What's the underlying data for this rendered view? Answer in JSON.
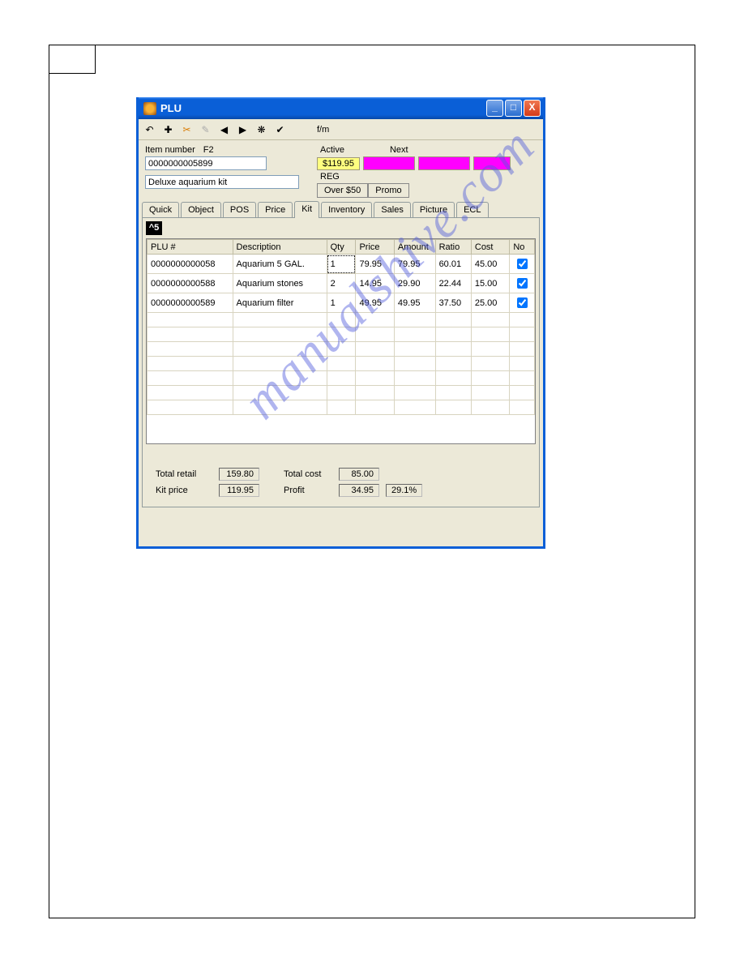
{
  "watermark": "manualshive.com",
  "window": {
    "title": "PLU",
    "toolbar_mode": "f/m",
    "item_number_label": "Item number",
    "f2_label": "F2",
    "item_number": "0000000005899",
    "description": "Deluxe aquarium kit",
    "active_label": "Active",
    "next_label": "Next",
    "price": "$119.95",
    "reg_label": "REG",
    "btn_over50": "Over $50",
    "btn_promo": "Promo"
  },
  "tabs": {
    "quick": "Quick",
    "object": "Object",
    "pos": "POS",
    "price": "Price",
    "kit": "Kit",
    "inventory": "Inventory",
    "sales": "Sales",
    "picture": "Picture",
    "ecl": "ECL"
  },
  "caret5": "^5",
  "grid": {
    "headers": {
      "plu": "PLU #",
      "desc": "Description",
      "qty": "Qty",
      "price": "Price",
      "amount": "Amount",
      "ratio": "Ratio",
      "cost": "Cost",
      "no": "No"
    },
    "rows": [
      {
        "plu": "0000000000058",
        "desc": "Aquarium 5 GAL.",
        "qty": "1",
        "price": "79.95",
        "amount": "79.95",
        "ratio": "60.01",
        "cost": "45.00",
        "no": true
      },
      {
        "plu": "0000000000588",
        "desc": "Aquarium stones",
        "qty": "2",
        "price": "14.95",
        "amount": "29.90",
        "ratio": "22.44",
        "cost": "15.00",
        "no": true
      },
      {
        "plu": "0000000000589",
        "desc": "Aquarium filter",
        "qty": "1",
        "price": "49.95",
        "amount": "49.95",
        "ratio": "37.50",
        "cost": "25.00",
        "no": true
      }
    ]
  },
  "totals": {
    "total_retail_label": "Total retail",
    "total_retail": "159.80",
    "kit_price_label": "Kit price",
    "kit_price": "119.95",
    "total_cost_label": "Total cost",
    "total_cost": "85.00",
    "profit_label": "Profit",
    "profit": "34.95",
    "profit_pct": "29.1%"
  }
}
